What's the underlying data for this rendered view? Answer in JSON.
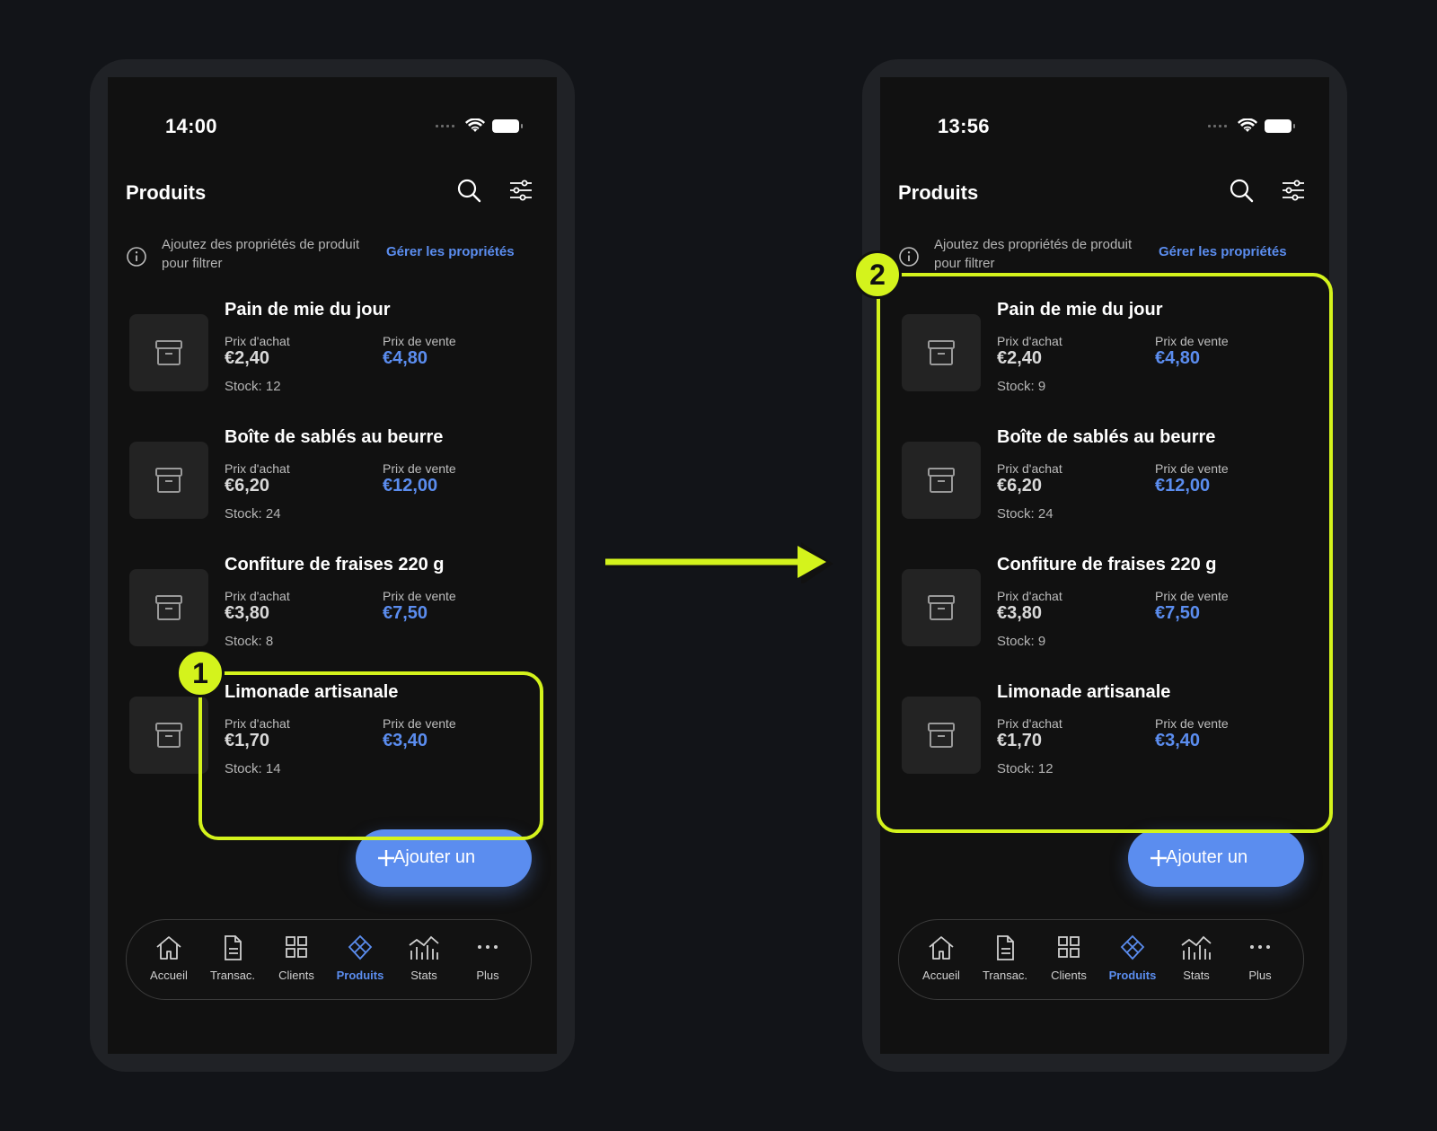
{
  "screens": [
    {
      "status_time": "14:00",
      "title": "Produits",
      "info_text": "Ajoutez des propriétés de produit pour filtrer",
      "info_link": "Gérer les propriétés",
      "products": [
        {
          "name": "Pain de mie du jour",
          "buy_label": "Prix d'achat",
          "buy": "€2,40",
          "sell_label": "Prix de vente",
          "sell": "€4,80",
          "stock": "Stock: 12"
        },
        {
          "name": "Boîte de sablés au beurre",
          "buy_label": "Prix d'achat",
          "buy": "€6,20",
          "sell_label": "Prix de vente",
          "sell": "€12,00",
          "stock": "Stock: 24"
        },
        {
          "name": "Confiture de fraises 220 g",
          "buy_label": "Prix d'achat",
          "buy": "€3,80",
          "sell_label": "Prix de vente",
          "sell": "€7,50",
          "stock": "Stock: 8"
        },
        {
          "name": "Limonade artisanale",
          "buy_label": "Prix d'achat",
          "buy": "€1,70",
          "sell_label": "Prix de vente",
          "sell": "€3,40",
          "stock": "Stock: 14"
        }
      ],
      "fab_label": "Ajouter un",
      "nav": [
        {
          "label": "Accueil",
          "icon": "home-icon"
        },
        {
          "label": "Transac.",
          "icon": "document-icon"
        },
        {
          "label": "Clients",
          "icon": "grid-icon"
        },
        {
          "label": "Produits",
          "icon": "cube-icon",
          "active": true
        },
        {
          "label": "Stats",
          "icon": "chart-icon"
        },
        {
          "label": "Plus",
          "icon": "more-icon"
        }
      ],
      "highlight_badge": "1"
    },
    {
      "status_time": "13:56",
      "title": "Produits",
      "info_text": "Ajoutez des propriétés de produit pour filtrer",
      "info_link": "Gérer les propriétés",
      "products": [
        {
          "name": "Pain de mie du jour",
          "buy_label": "Prix d'achat",
          "buy": "€2,40",
          "sell_label": "Prix de vente",
          "sell": "€4,80",
          "stock": "Stock: 9"
        },
        {
          "name": "Boîte de sablés au beurre",
          "buy_label": "Prix d'achat",
          "buy": "€6,20",
          "sell_label": "Prix de vente",
          "sell": "€12,00",
          "stock": "Stock: 24"
        },
        {
          "name": "Confiture de fraises 220 g",
          "buy_label": "Prix d'achat",
          "buy": "€3,80",
          "sell_label": "Prix de vente",
          "sell": "€7,50",
          "stock": "Stock: 9"
        },
        {
          "name": "Limonade artisanale",
          "buy_label": "Prix d'achat",
          "buy": "€1,70",
          "sell_label": "Prix de vente",
          "sell": "€3,40",
          "stock": "Stock: 12"
        }
      ],
      "fab_label": "Ajouter un",
      "nav": [
        {
          "label": "Accueil",
          "icon": "home-icon"
        },
        {
          "label": "Transac.",
          "icon": "document-icon"
        },
        {
          "label": "Clients",
          "icon": "grid-icon"
        },
        {
          "label": "Produits",
          "icon": "cube-icon",
          "active": true
        },
        {
          "label": "Stats",
          "icon": "chart-icon"
        },
        {
          "label": "Plus",
          "icon": "more-icon"
        }
      ],
      "highlight_badge": "2"
    }
  ],
  "colors": {
    "accent": "#5b8def",
    "highlight": "#d4f31c",
    "background": "#121418"
  }
}
